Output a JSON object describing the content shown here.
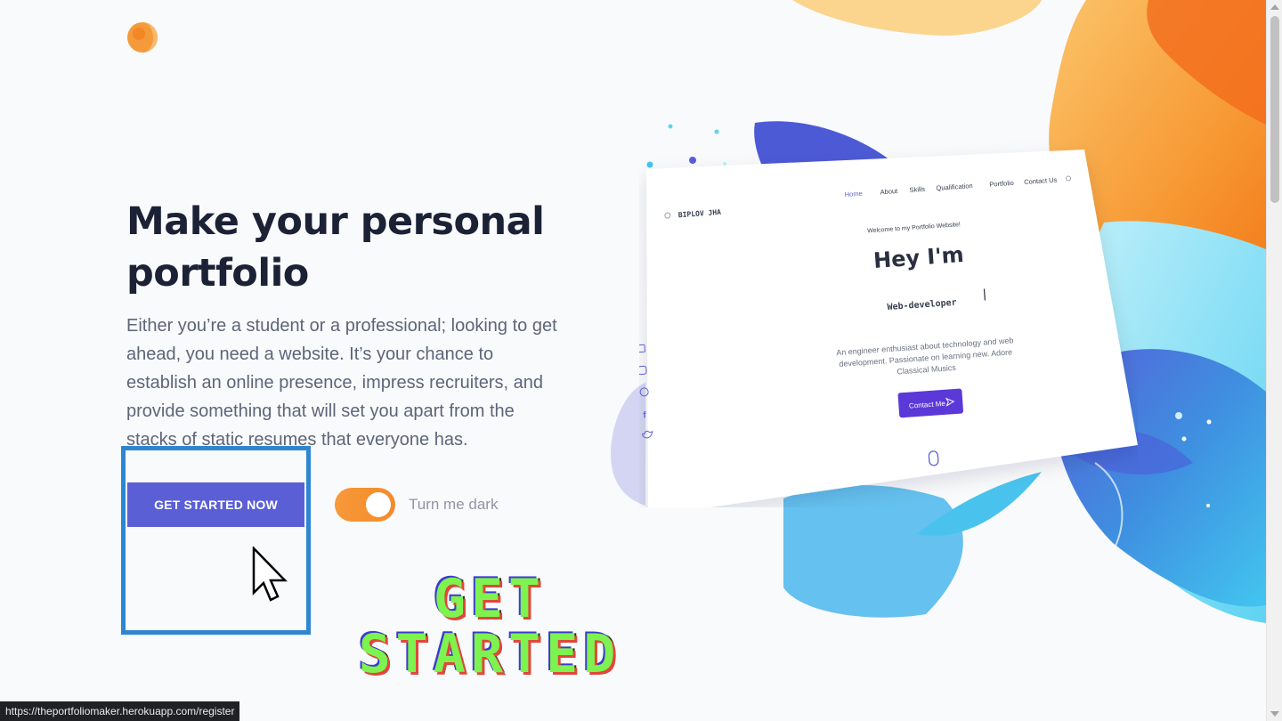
{
  "hero": {
    "title_line1": "Make your personal",
    "title_line2": "portfolio",
    "description": "Either you’re a student or a professional; looking to get ahead, you need a website. It’s your chance to establish an online presence, impress recruiters, and provide something that will set you apart from the stacks of static resumes that everyone has."
  },
  "actions": {
    "cta_label": "GET STARTED NOW",
    "toggle_label": "Turn me dark",
    "toggle_on": true
  },
  "mockup": {
    "brand": "BIPLOV JHA",
    "nav": [
      "Home",
      "About",
      "Skills",
      "Qualification",
      "Portfolio",
      "Contact Us"
    ],
    "welcome": "Welcome to my Portfolio Website!",
    "heading": "Hey I'm",
    "role": "Web-developer",
    "bio_line1": "An engineer enthusiast about technology and web",
    "bio_line2": "development. Passionate on learning new. Adore",
    "bio_line3": "Classical Musics",
    "contact_button": "Contact Me",
    "social_icons": [
      "linkedin-icon",
      "instagram-icon",
      "github-icon",
      "facebook-icon",
      "twitter-icon"
    ]
  },
  "overlay": {
    "line1": "GET",
    "line2": "STARTED"
  },
  "status_bar": {
    "url": "https://theportfoliomaker.herokuapp.com/register"
  },
  "colors": {
    "primary": "#5b5fd6",
    "accent_orange": "#f7993a",
    "highlight_border": "#2f86d0",
    "title": "#1b2236",
    "overlay_text": "#7ef24e"
  }
}
